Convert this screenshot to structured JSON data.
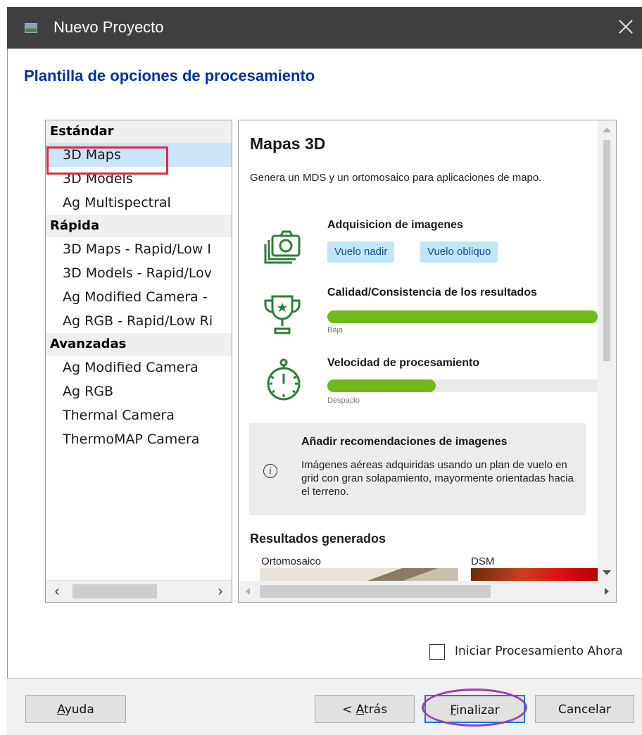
{
  "window": {
    "title": "Nuevo Proyecto"
  },
  "heading": "Plantilla de opciones de procesamiento",
  "template_list": {
    "groups": [
      {
        "label": "Estándar",
        "items": [
          "3D Maps",
          "3D Models",
          "Ag Multispectral"
        ]
      },
      {
        "label": "Rápida",
        "items": [
          "3D Maps - Rapid/Low I",
          "3D Models - Rapid/Lov",
          "Ag Modified Camera -",
          "Ag RGB - Rapid/Low Ri"
        ]
      },
      {
        "label": "Avanzadas",
        "items": [
          "Ag Modified Camera",
          "Ag RGB",
          "Thermal Camera",
          "ThermoMAP Camera"
        ]
      }
    ],
    "selected": "3D Maps"
  },
  "detail": {
    "title": "Mapas 3D",
    "description": "Genera un MDS y un ortomosaico para aplicaciones de mapo.",
    "acquisition": {
      "label": "Adquisicion de imagenes",
      "tags": [
        "Vuelo nadir",
        "Vuelo obliquo"
      ]
    },
    "quality": {
      "label": "Calidad/Consistencia de los resultados",
      "caption": "Baja",
      "level": 1.0
    },
    "speed": {
      "label": "Velocidad de procesamiento",
      "caption": "Despacio",
      "level": 0.4
    },
    "recommendation": {
      "title": "Añadir recomendaciones de imagenes",
      "text": "Imágenes aéreas adquiridas usando un plan de vuelo en grid con gran solapamiento, mayormente orientadas hacia el terreno."
    },
    "results": {
      "title": "Resultados generados",
      "items": [
        "Ortomosaico",
        "DSM"
      ]
    }
  },
  "start_now": {
    "label": "Iniciar Procesamiento Ahora",
    "checked": false
  },
  "buttons": {
    "help": {
      "accel": "A",
      "rest": "yuda"
    },
    "back": {
      "prefix": "< ",
      "accel": "A",
      "rest": "trás"
    },
    "finish": {
      "accel": "F",
      "rest": "inalizar"
    },
    "cancel": "Cancelar"
  },
  "colors": {
    "heading": "#003399",
    "bar": "#72b81a",
    "tag_bg": "#bfe6f7",
    "selection": "#cce4f7",
    "highlight_red": "#d92c3c",
    "highlight_purple": "#9b3fb6"
  }
}
